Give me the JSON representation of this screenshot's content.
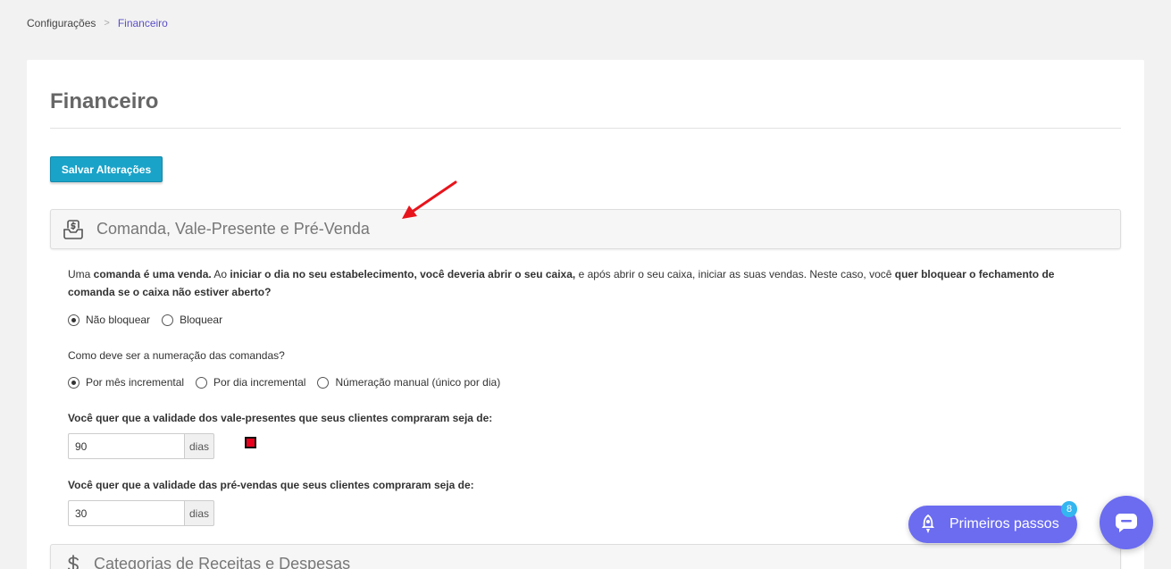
{
  "breadcrumb": {
    "items": [
      "Configurações",
      "Financeiro"
    ],
    "separator": ">"
  },
  "page": {
    "title": "Financeiro",
    "save_label": "Salvar Alterações"
  },
  "sections": {
    "comanda": {
      "title": "Comanda, Vale-Presente e Pré-Venda",
      "icon": "money-tray-icon"
    },
    "categorias": {
      "title": "Categorias de Receitas e Despesas",
      "icon": "dollar-icon"
    }
  },
  "question1": {
    "parts": [
      "Uma ",
      "comanda é uma venda.",
      " Ao ",
      "iniciar o dia no seu estabelecimento, você deveria abrir o seu caixa,",
      " e após abrir o seu caixa, iniciar as suas vendas. Neste caso, você ",
      "quer bloquear o fechamento de comanda se o caixa não estiver aberto?"
    ],
    "options": [
      "Não bloquear",
      "Bloquear"
    ],
    "selected": 0
  },
  "question2": {
    "text": "Como deve ser a numeração das comandas?",
    "options": [
      "Por mês incremental",
      "Por dia incremental",
      "Númeração manual (único por dia)"
    ],
    "selected": 0
  },
  "question3": {
    "text": "Você quer que a validade dos vale-presentes que seus clientes compraram seja de:",
    "value": "90",
    "unit": "dias"
  },
  "question4": {
    "text": "Você quer que a validade das pré-vendas que seus clientes compraram seja de:",
    "value": "30",
    "unit": "dias"
  },
  "widgets": {
    "primeiros_passos_label": "Primeiros passos",
    "badge_count": "8"
  },
  "colors": {
    "accent": "#1aa3c9",
    "breadcrumb_active": "#5b4fc7",
    "widget": "#6b6cf0",
    "badge": "#34b6f0",
    "annotation_arrow": "#e8141c"
  }
}
